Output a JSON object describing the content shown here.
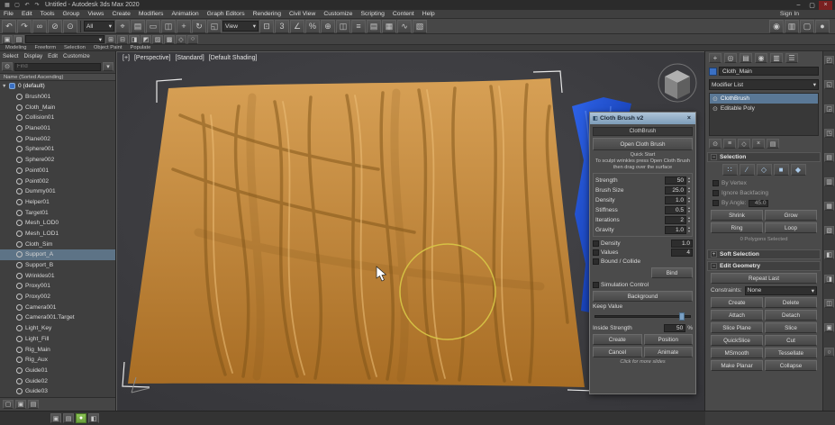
{
  "colors": {
    "accent": "#5a7896",
    "selection_blue": "#5d7386",
    "cloth_top": "#d7a055",
    "cloth_bottom": "#a86d24",
    "cloth_wrinkle": "#7e5317",
    "cloth_highlight": "#eec079",
    "blue_top": "#2e63e8",
    "blue_bottom": "#0a2c96",
    "blue_highlight": "#6f9bff",
    "brush_ring": "#d8c847",
    "green_status": "#7ab648"
  },
  "title_bar": {
    "title": "Untitled - Autodesk 3ds Max 2020",
    "icons": [
      {
        "g": "▦",
        "n": "app-logo-icon"
      },
      {
        "g": "▢",
        "n": "save-icon"
      },
      {
        "g": "↶",
        "n": "qat-undo-icon"
      },
      {
        "g": "↷",
        "n": "qat-redo-icon"
      }
    ],
    "controls": [
      {
        "g": "–",
        "n": "minimize-button"
      },
      {
        "g": "▢",
        "n": "maximize-button"
      },
      {
        "g": "×",
        "n": "close-button"
      }
    ]
  },
  "menu_bar": {
    "items": [
      "File",
      "Edit",
      "Tools",
      "Group",
      "Views",
      "Create",
      "Modifiers",
      "Animation",
      "Graph Editors",
      "Rendering",
      "Civil View",
      "Customize",
      "Scripting",
      "Content",
      "Help"
    ],
    "sign_in": "Sign In"
  },
  "toolbar1": {
    "segA": [
      {
        "g": "↶",
        "n": "undo-icon"
      },
      {
        "g": "↷",
        "n": "redo-icon"
      },
      {
        "g": "∞",
        "n": "select-and-link-icon"
      },
      {
        "g": "⊘",
        "n": "unlink-selection-icon"
      },
      {
        "g": "⊙",
        "n": "bind-to-space-warp-icon"
      }
    ],
    "filter_combo": "All",
    "segB": [
      {
        "g": "⌖",
        "n": "select-object-icon"
      },
      {
        "g": "▤",
        "n": "select-by-name-icon"
      },
      {
        "g": "▭",
        "n": "rectangular-region-icon"
      },
      {
        "g": "◫",
        "n": "window-crossing-toggle-icon"
      },
      {
        "g": "+",
        "n": "select-and-move-icon"
      },
      {
        "g": "↻",
        "n": "select-and-rotate-icon"
      },
      {
        "g": "◱",
        "n": "select-and-scale-icon"
      }
    ],
    "coord_combo": "View",
    "segC": [
      {
        "g": "⊡",
        "n": "use-pivot-center-icon"
      },
      {
        "g": "3",
        "n": "snaps-toggle-3d-icon"
      },
      {
        "g": "∠",
        "n": "angle-snap-icon"
      },
      {
        "g": "%",
        "n": "percent-snap-icon"
      },
      {
        "g": "⊕",
        "n": "spinner-snap-icon"
      },
      {
        "g": "◫",
        "n": "mirror-icon"
      },
      {
        "g": "≡",
        "n": "align-icon"
      },
      {
        "g": "▤",
        "n": "toggle-layer-explorer-icon"
      },
      {
        "g": "▦",
        "n": "toggle-ribbon-icon"
      },
      {
        "g": "∿",
        "n": "curve-editor-icon"
      },
      {
        "g": "▧",
        "n": "schematic-view-icon"
      }
    ],
    "segD": [
      {
        "g": "◉",
        "n": "material-editor-icon"
      },
      {
        "g": "▥",
        "n": "render-setup-icon"
      },
      {
        "g": "▢",
        "n": "rendered-frame-window-icon"
      },
      {
        "g": "●",
        "n": "render-production-icon"
      }
    ]
  },
  "toolbar2": {
    "segA": [
      {
        "g": "▣",
        "n": "edit-named-selections-icon"
      },
      {
        "g": "▤",
        "n": "named-sets-list-icon"
      }
    ],
    "combo_label": "",
    "segB": [
      {
        "g": "⊞",
        "n": "snap-grid-icon"
      },
      {
        "g": "⊟",
        "n": "snap-edge-icon"
      },
      {
        "g": "◨",
        "n": "axis-x-constraint-icon"
      },
      {
        "g": "◩",
        "n": "axis-y-constraint-icon"
      },
      {
        "g": "▨",
        "n": "axis-z-constraint-icon"
      },
      {
        "g": "▩",
        "n": "axis-plane-constraint-icon"
      },
      {
        "g": "◇",
        "n": "soft-selection-icon"
      },
      {
        "g": "○",
        "n": "paint-selection-icon"
      }
    ]
  },
  "ribbon": {
    "tabs": [
      "Modeling",
      "Freeform",
      "Selection",
      "Object Paint",
      "Populate"
    ]
  },
  "scene_explorer": {
    "menu": [
      "Select",
      "Display",
      "Edit",
      "Customize"
    ],
    "search_placeholder": "Find",
    "column_header": "Name (Sorted Ascending)",
    "rows": [
      {
        "name": "0 (default)",
        "caret": "▼",
        "header": true
      },
      {
        "name": "Brush001"
      },
      {
        "name": "Cloth_Main"
      },
      {
        "name": "Collision01"
      },
      {
        "name": "Plane001"
      },
      {
        "name": "Plane002"
      },
      {
        "name": "Sphere001"
      },
      {
        "name": "Sphere002"
      },
      {
        "name": "Point001"
      },
      {
        "name": "Point002"
      },
      {
        "name": "Dummy001"
      },
      {
        "name": "Helper01"
      },
      {
        "name": "Target01"
      },
      {
        "name": "Mesh_LOD0"
      },
      {
        "name": "Mesh_LOD1"
      },
      {
        "name": "Cloth_Sim"
      },
      {
        "name": "Support_A",
        "selected": true
      },
      {
        "name": "Support_B"
      },
      {
        "name": "Wrinkles01"
      },
      {
        "name": "Proxy001"
      },
      {
        "name": "Proxy002"
      },
      {
        "name": "Camera001"
      },
      {
        "name": "Camera001.Target"
      },
      {
        "name": "Light_Key"
      },
      {
        "name": "Light_Fill"
      },
      {
        "name": "Rig_Main"
      },
      {
        "name": "Rig_Aux"
      },
      {
        "name": "Guide01"
      },
      {
        "name": "Guide02"
      },
      {
        "name": "Guide03"
      }
    ],
    "footer_icons": [
      {
        "g": "▢",
        "n": "explorer-lock-icon"
      },
      {
        "g": "▣",
        "n": "explorer-pick-icon"
      },
      {
        "g": "▤",
        "n": "explorer-settings-icon"
      }
    ]
  },
  "viewport": {
    "label": {
      "plus": "[+]",
      "view": "[Perspective]",
      "style": "[Standard]",
      "shading": "[Default Shading]"
    }
  },
  "dialog": {
    "title": "Cloth Brush v2",
    "close": "×",
    "header_label": "ClothBrush",
    "open_button": "Open Cloth Brush",
    "desc_lines": [
      "Quick Start",
      "To sculpt wrinkles press Open Cloth Brush",
      "then drag over the surface"
    ],
    "params": [
      {
        "label": "Strength",
        "value": "50"
      },
      {
        "label": "Brush Size",
        "value": "25.0"
      },
      {
        "label": "Density",
        "value": "1.0"
      },
      {
        "label": "Stiffness",
        "value": "0.5"
      },
      {
        "label": "Iterations",
        "value": "2"
      },
      {
        "label": "Gravity",
        "value": "1.0"
      }
    ],
    "checks": [
      {
        "label": "Density",
        "value": "1.0"
      },
      {
        "label": "Values",
        "value": "4"
      },
      {
        "label": "Bound / Collide",
        "value": ""
      }
    ],
    "bind_button": "Bind",
    "sim_check": "Simulation Control",
    "background_button": "Background",
    "keep_label": "Keep Value",
    "slider_percent": 88,
    "inside_label": "Inside Strength",
    "inside_value": "50",
    "inside_unit": "%",
    "buttons": [
      "Create",
      "Position",
      "Cancel",
      "Animate"
    ],
    "footer": "Click for more slides"
  },
  "command_panel": {
    "tabs": [
      {
        "g": "+",
        "n": "create-tab-icon"
      },
      {
        "g": "◎",
        "n": "modify-tab-icon"
      },
      {
        "g": "▤",
        "n": "hierarchy-tab-icon"
      },
      {
        "g": "◉",
        "n": "motion-tab-icon"
      },
      {
        "g": "▥",
        "n": "display-tab-icon"
      },
      {
        "g": "☰",
        "n": "utilities-tab-icon"
      }
    ],
    "object_name": "Cloth_Main",
    "modifier_list_label": "Modifier List",
    "stack": [
      {
        "g": "⊙",
        "label": "ClothBrush",
        "selected": true
      },
      {
        "g": "⊙",
        "label": "Editable Poly"
      }
    ],
    "stack_tools": [
      {
        "g": "⊙",
        "n": "pin-stack-icon"
      },
      {
        "g": "≡",
        "n": "show-end-result-icon"
      },
      {
        "g": "◇",
        "n": "make-unique-icon"
      },
      {
        "g": "×",
        "n": "remove-modifier-icon"
      },
      {
        "g": "▤",
        "n": "configure-modifier-sets-icon"
      }
    ],
    "selection": {
      "title": "Selection",
      "modes": [
        {
          "g": "∷",
          "n": "vertex-mode-icon"
        },
        {
          "g": "∕",
          "n": "edge-mode-icon"
        },
        {
          "g": "◇",
          "n": "border-mode-icon"
        },
        {
          "g": "■",
          "n": "polygon-mode-icon"
        },
        {
          "g": "◆",
          "n": "element-mode-icon"
        }
      ],
      "checks": [
        "By Vertex",
        "Ignore Backfacing"
      ],
      "angle_label": "By Angle:",
      "angle_value": "45.0",
      "buttons": [
        "Shrink",
        "Grow",
        "Ring",
        "Loop"
      ],
      "status": "0 Polygons Selected"
    },
    "soft_selection_title": "Soft Selection",
    "edit_geometry": {
      "title": "Edit Geometry",
      "wide_button": "Repeat Last",
      "constraints_label": "Constraints:",
      "constraints_value": "None",
      "buttons": [
        "Create",
        "Delete",
        "Attach",
        "Detach",
        "Slice Plane",
        "Slice",
        "QuickSlice",
        "Cut",
        "MSmooth",
        "Tessellate",
        "Make Planar",
        "Collapse"
      ]
    }
  },
  "side_strip": {
    "icons": [
      {
        "g": "◰",
        "n": "docked-tool-icon"
      },
      {
        "g": "◱",
        "n": "docked-tool-icon"
      },
      {
        "g": "◲",
        "n": "docked-tool-icon"
      },
      {
        "g": "◳",
        "n": "docked-tool-icon"
      },
      {
        "g": "▤",
        "n": "docked-tool-icon"
      },
      {
        "g": "▥",
        "n": "docked-tool-icon"
      },
      {
        "g": "▦",
        "n": "docked-tool-icon"
      },
      {
        "g": "▧",
        "n": "docked-tool-icon"
      },
      {
        "g": "◧",
        "n": "docked-tool-icon"
      },
      {
        "g": "◨",
        "n": "docked-tool-icon"
      },
      {
        "g": "◫",
        "n": "docked-tool-icon"
      },
      {
        "g": "▣",
        "n": "docked-tool-icon"
      },
      {
        "g": "○",
        "n": "docked-tool-icon"
      }
    ]
  },
  "status_bar": {
    "icons": [
      {
        "g": "▣",
        "n": "maxscript-listener-icon"
      },
      {
        "g": "▤",
        "n": "log-icon"
      },
      {
        "g": "●",
        "n": "isolate-selection-icon",
        "type": "green"
      },
      {
        "g": "◧",
        "n": "selection-lock-icon"
      }
    ]
  }
}
